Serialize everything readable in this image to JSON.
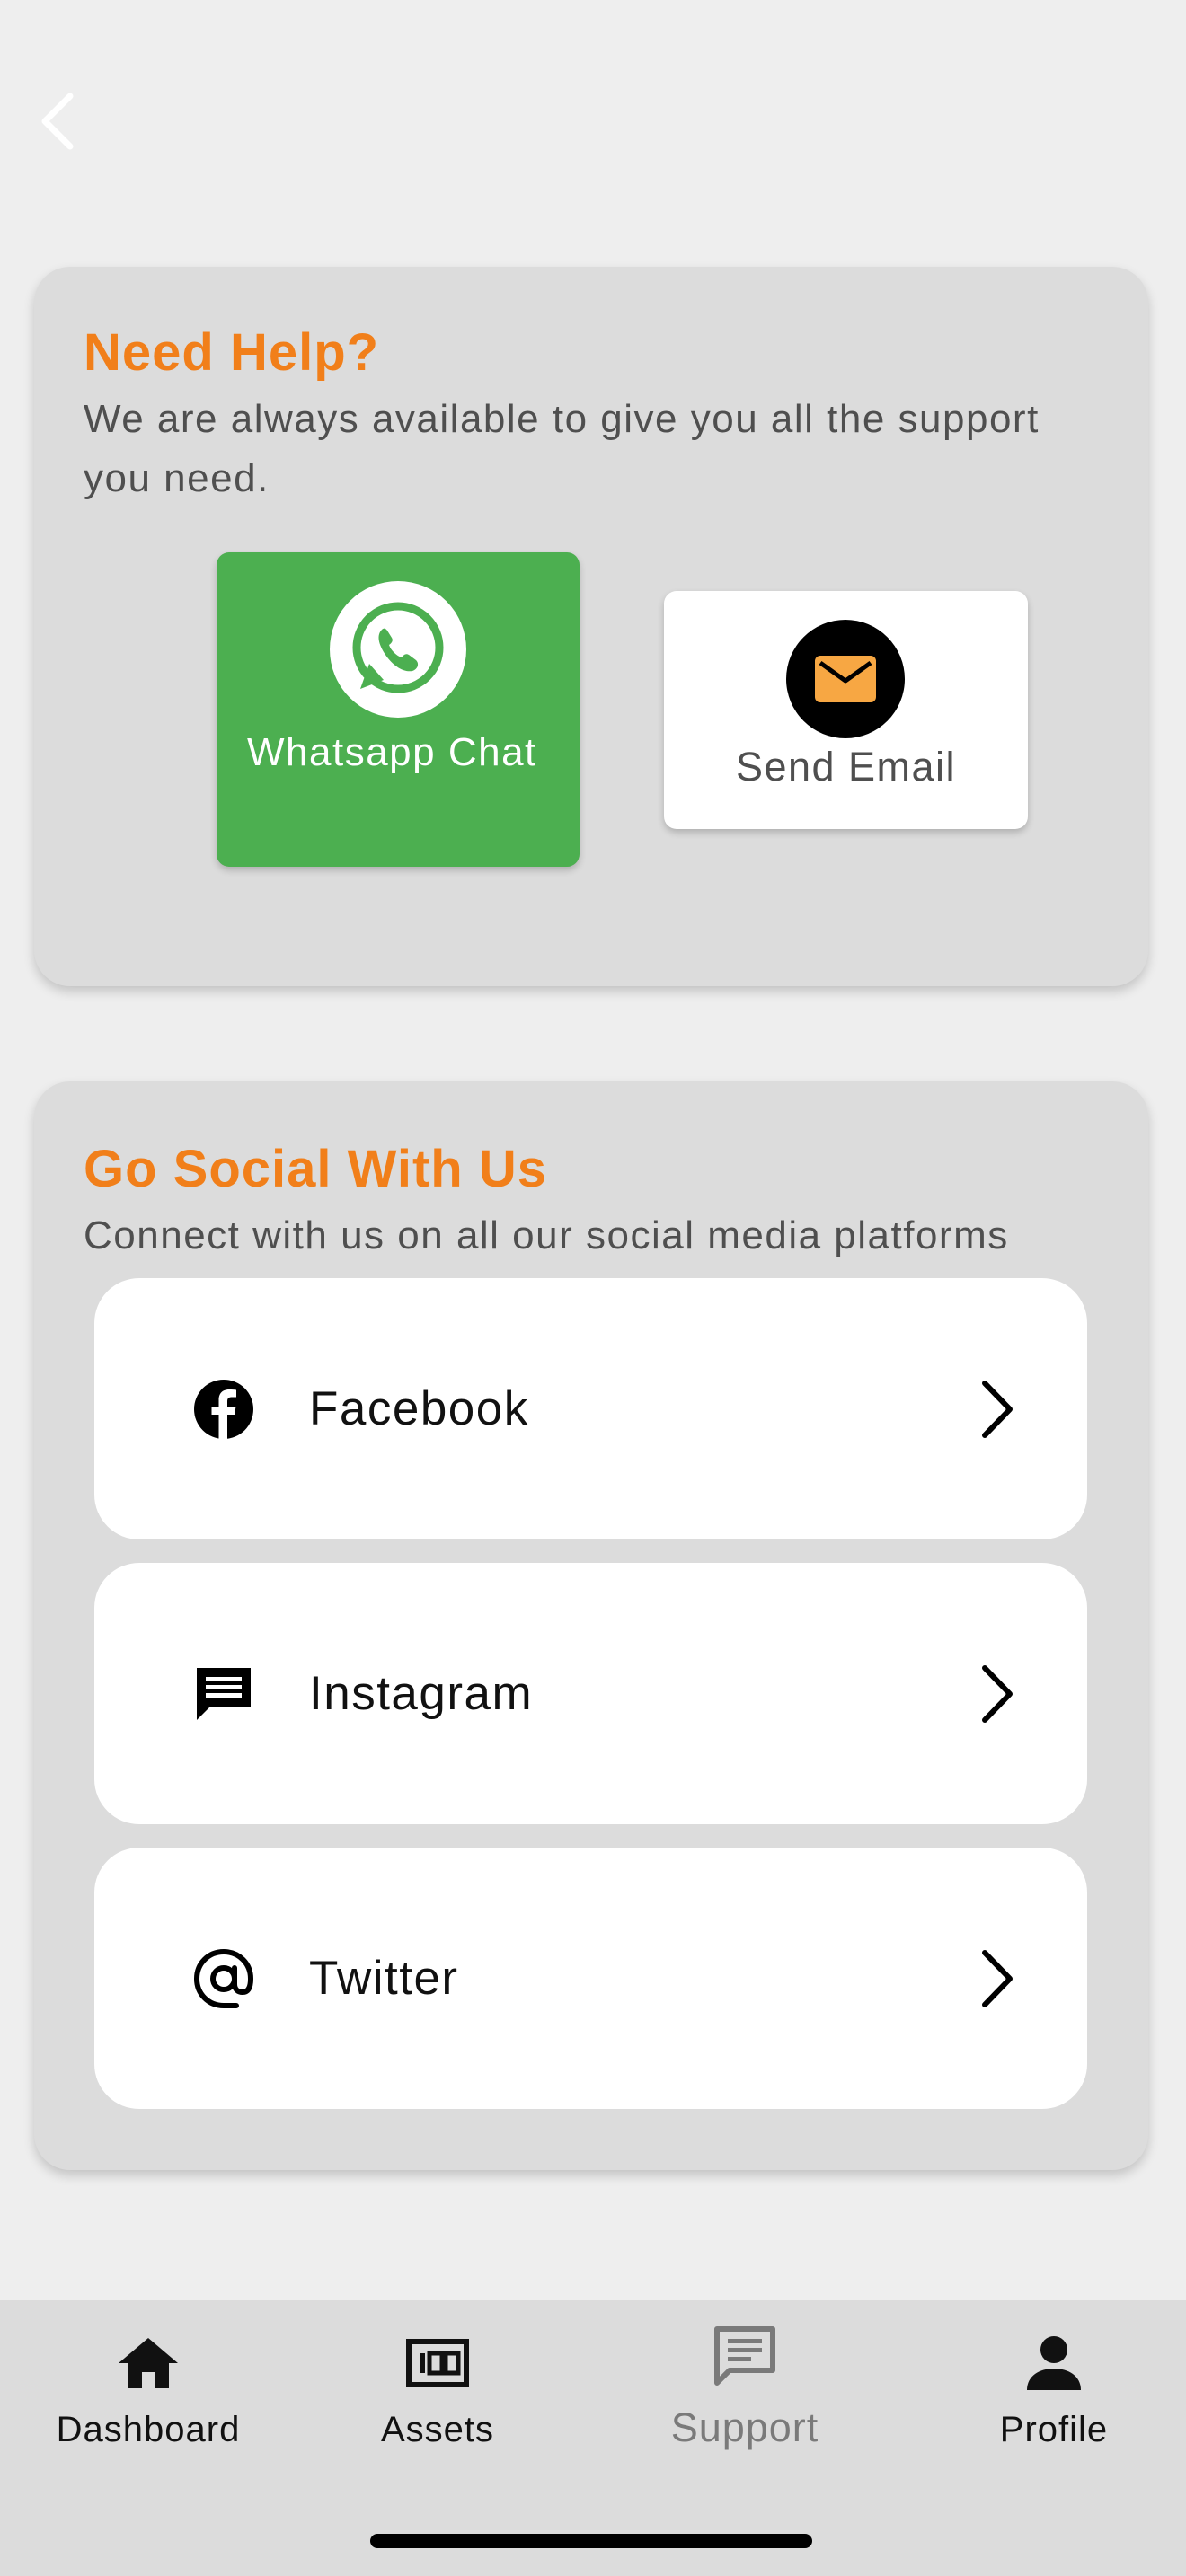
{
  "help": {
    "title": "Need Help?",
    "subtitle": "We are always available to give you all the support you need.",
    "whatsapp_label": "Whatsapp Chat",
    "email_label": "Send Email"
  },
  "social": {
    "title": "Go Social With Us",
    "subtitle": "Connect with us on all our social media platforms",
    "items": [
      {
        "label": "Facebook",
        "icon": "facebook-icon"
      },
      {
        "label": "Instagram",
        "icon": "chat-bubble-icon"
      },
      {
        "label": "Twitter",
        "icon": "at-sign-icon"
      }
    ]
  },
  "nav": {
    "items": [
      {
        "label": "Dashboard",
        "icon": "home-icon"
      },
      {
        "label": "Assets",
        "icon": "money-icon"
      },
      {
        "label": "Support",
        "icon": "support-chat-icon",
        "active": true
      },
      {
        "label": "Profile",
        "icon": "person-icon"
      }
    ]
  },
  "colors": {
    "accent": "#f17f1a",
    "whatsapp": "#4caf50",
    "email_icon": "#f7a743",
    "card_bg": "#dcdcdc",
    "page_bg": "#eeeeee"
  }
}
